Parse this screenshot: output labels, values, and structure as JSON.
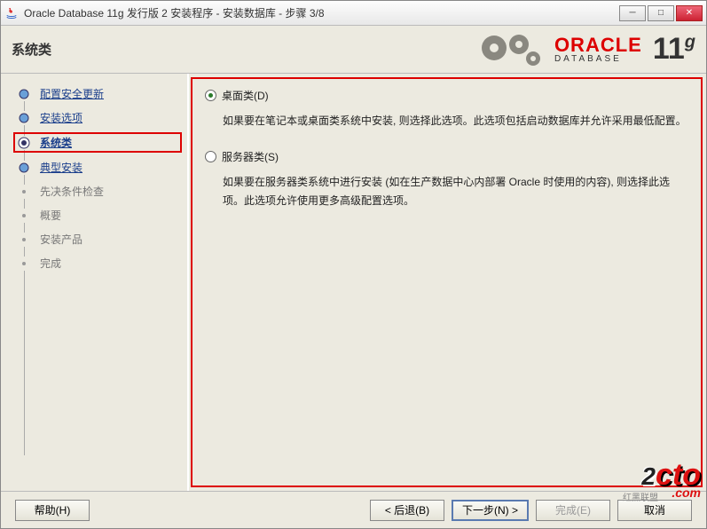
{
  "window": {
    "title": "Oracle Database 11g 发行版 2 安装程序 - 安装数据库 - 步骤 3/8"
  },
  "header": {
    "title": "系统类",
    "brand_word": "ORACLE",
    "brand_sub": "DATABASE",
    "brand_version": "11",
    "brand_version_suffix": "g"
  },
  "sidebar": {
    "steps": [
      {
        "label": "配置安全更新",
        "state": "done"
      },
      {
        "label": "安装选项",
        "state": "done"
      },
      {
        "label": "系统类",
        "state": "active"
      },
      {
        "label": "典型安装",
        "state": "done"
      },
      {
        "label": "先决条件检查",
        "state": "pending"
      },
      {
        "label": "概要",
        "state": "pending"
      },
      {
        "label": "安装产品",
        "state": "pending"
      },
      {
        "label": "完成",
        "state": "pending"
      }
    ]
  },
  "content": {
    "options": [
      {
        "label": "桌面类(D)",
        "selected": true,
        "desc": "如果要在笔记本或桌面类系统中安装, 则选择此选项。此选项包括启动数据库并允许采用最低配置。"
      },
      {
        "label": "服务器类(S)",
        "selected": false,
        "desc": "如果要在服务器类系统中进行安装 (如在生产数据中心内部署 Oracle 时使用的内容), 则选择此选项。此选项允许使用更多高级配置选项。"
      }
    ]
  },
  "footer": {
    "help": "帮助(H)",
    "back": "< 后退(B)",
    "next": "下一步(N) >",
    "finish": "完成(E)",
    "cancel": "取消"
  },
  "watermark": {
    "sub": "红黑联盟",
    "two": "2",
    "cto": "cto",
    "com": ".com"
  }
}
